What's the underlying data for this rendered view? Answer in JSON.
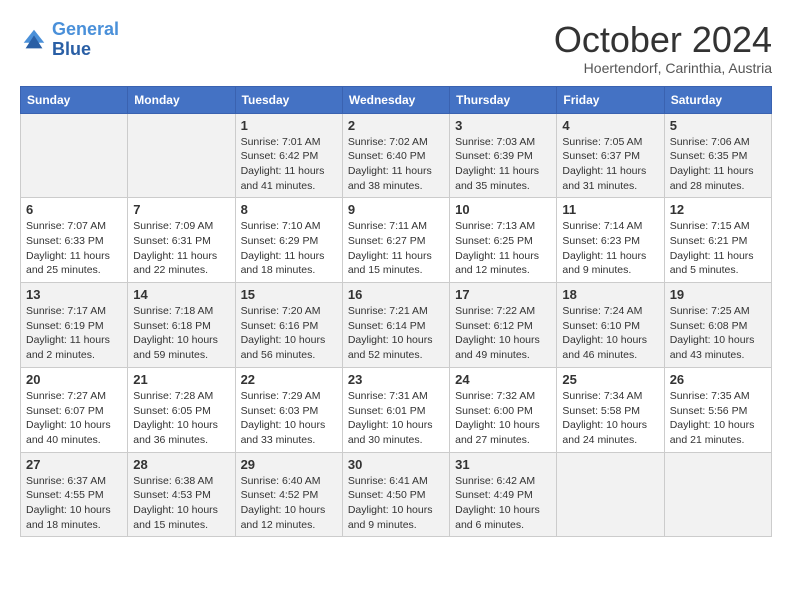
{
  "header": {
    "logo_line1": "General",
    "logo_line2": "Blue",
    "month": "October 2024",
    "location": "Hoertendorf, Carinthia, Austria"
  },
  "days_of_week": [
    "Sunday",
    "Monday",
    "Tuesday",
    "Wednesday",
    "Thursday",
    "Friday",
    "Saturday"
  ],
  "weeks": [
    [
      {
        "day": "",
        "info": ""
      },
      {
        "day": "",
        "info": ""
      },
      {
        "day": "1",
        "info": "Sunrise: 7:01 AM\nSunset: 6:42 PM\nDaylight: 11 hours and 41 minutes."
      },
      {
        "day": "2",
        "info": "Sunrise: 7:02 AM\nSunset: 6:40 PM\nDaylight: 11 hours and 38 minutes."
      },
      {
        "day": "3",
        "info": "Sunrise: 7:03 AM\nSunset: 6:39 PM\nDaylight: 11 hours and 35 minutes."
      },
      {
        "day": "4",
        "info": "Sunrise: 7:05 AM\nSunset: 6:37 PM\nDaylight: 11 hours and 31 minutes."
      },
      {
        "day": "5",
        "info": "Sunrise: 7:06 AM\nSunset: 6:35 PM\nDaylight: 11 hours and 28 minutes."
      }
    ],
    [
      {
        "day": "6",
        "info": "Sunrise: 7:07 AM\nSunset: 6:33 PM\nDaylight: 11 hours and 25 minutes."
      },
      {
        "day": "7",
        "info": "Sunrise: 7:09 AM\nSunset: 6:31 PM\nDaylight: 11 hours and 22 minutes."
      },
      {
        "day": "8",
        "info": "Sunrise: 7:10 AM\nSunset: 6:29 PM\nDaylight: 11 hours and 18 minutes."
      },
      {
        "day": "9",
        "info": "Sunrise: 7:11 AM\nSunset: 6:27 PM\nDaylight: 11 hours and 15 minutes."
      },
      {
        "day": "10",
        "info": "Sunrise: 7:13 AM\nSunset: 6:25 PM\nDaylight: 11 hours and 12 minutes."
      },
      {
        "day": "11",
        "info": "Sunrise: 7:14 AM\nSunset: 6:23 PM\nDaylight: 11 hours and 9 minutes."
      },
      {
        "day": "12",
        "info": "Sunrise: 7:15 AM\nSunset: 6:21 PM\nDaylight: 11 hours and 5 minutes."
      }
    ],
    [
      {
        "day": "13",
        "info": "Sunrise: 7:17 AM\nSunset: 6:19 PM\nDaylight: 11 hours and 2 minutes."
      },
      {
        "day": "14",
        "info": "Sunrise: 7:18 AM\nSunset: 6:18 PM\nDaylight: 10 hours and 59 minutes."
      },
      {
        "day": "15",
        "info": "Sunrise: 7:20 AM\nSunset: 6:16 PM\nDaylight: 10 hours and 56 minutes."
      },
      {
        "day": "16",
        "info": "Sunrise: 7:21 AM\nSunset: 6:14 PM\nDaylight: 10 hours and 52 minutes."
      },
      {
        "day": "17",
        "info": "Sunrise: 7:22 AM\nSunset: 6:12 PM\nDaylight: 10 hours and 49 minutes."
      },
      {
        "day": "18",
        "info": "Sunrise: 7:24 AM\nSunset: 6:10 PM\nDaylight: 10 hours and 46 minutes."
      },
      {
        "day": "19",
        "info": "Sunrise: 7:25 AM\nSunset: 6:08 PM\nDaylight: 10 hours and 43 minutes."
      }
    ],
    [
      {
        "day": "20",
        "info": "Sunrise: 7:27 AM\nSunset: 6:07 PM\nDaylight: 10 hours and 40 minutes."
      },
      {
        "day": "21",
        "info": "Sunrise: 7:28 AM\nSunset: 6:05 PM\nDaylight: 10 hours and 36 minutes."
      },
      {
        "day": "22",
        "info": "Sunrise: 7:29 AM\nSunset: 6:03 PM\nDaylight: 10 hours and 33 minutes."
      },
      {
        "day": "23",
        "info": "Sunrise: 7:31 AM\nSunset: 6:01 PM\nDaylight: 10 hours and 30 minutes."
      },
      {
        "day": "24",
        "info": "Sunrise: 7:32 AM\nSunset: 6:00 PM\nDaylight: 10 hours and 27 minutes."
      },
      {
        "day": "25",
        "info": "Sunrise: 7:34 AM\nSunset: 5:58 PM\nDaylight: 10 hours and 24 minutes."
      },
      {
        "day": "26",
        "info": "Sunrise: 7:35 AM\nSunset: 5:56 PM\nDaylight: 10 hours and 21 minutes."
      }
    ],
    [
      {
        "day": "27",
        "info": "Sunrise: 6:37 AM\nSunset: 4:55 PM\nDaylight: 10 hours and 18 minutes."
      },
      {
        "day": "28",
        "info": "Sunrise: 6:38 AM\nSunset: 4:53 PM\nDaylight: 10 hours and 15 minutes."
      },
      {
        "day": "29",
        "info": "Sunrise: 6:40 AM\nSunset: 4:52 PM\nDaylight: 10 hours and 12 minutes."
      },
      {
        "day": "30",
        "info": "Sunrise: 6:41 AM\nSunset: 4:50 PM\nDaylight: 10 hours and 9 minutes."
      },
      {
        "day": "31",
        "info": "Sunrise: 6:42 AM\nSunset: 4:49 PM\nDaylight: 10 hours and 6 minutes."
      },
      {
        "day": "",
        "info": ""
      },
      {
        "day": "",
        "info": ""
      }
    ]
  ]
}
